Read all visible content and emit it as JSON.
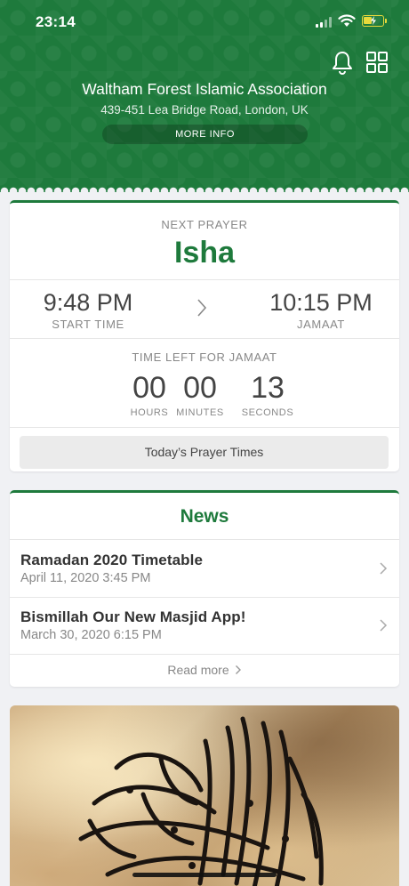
{
  "status_bar": {
    "time": "23:14"
  },
  "header": {
    "org_name": "Waltham Forest Islamic Association",
    "address": "439-451 Lea Bridge Road, London, UK",
    "more_info_label": "MORE INFO"
  },
  "next_prayer": {
    "label": "NEXT PRAYER",
    "name": "Isha",
    "start_time": "9:48 PM",
    "start_label": "START TIME",
    "jamaat_time": "10:15 PM",
    "jamaat_label": "JAMAAT",
    "countdown_title": "TIME LEFT FOR JAMAAT",
    "hours": "00",
    "hours_label": "HOURS",
    "minutes": "00",
    "minutes_label": "MINUTES",
    "seconds": "13",
    "seconds_label": "SECONDS",
    "button_label": "Today’s Prayer Times"
  },
  "news": {
    "title": "News",
    "items": [
      {
        "headline": "Ramadan 2020 Timetable",
        "date": "April 11, 2020 3:45 PM"
      },
      {
        "headline": "Bismillah Our New Masjid App!",
        "date": "March 30, 2020 6:15 PM"
      }
    ],
    "read_more_label": "Read more"
  },
  "colors": {
    "brand": "#1e7a3c",
    "battery": "#e8d93c"
  }
}
